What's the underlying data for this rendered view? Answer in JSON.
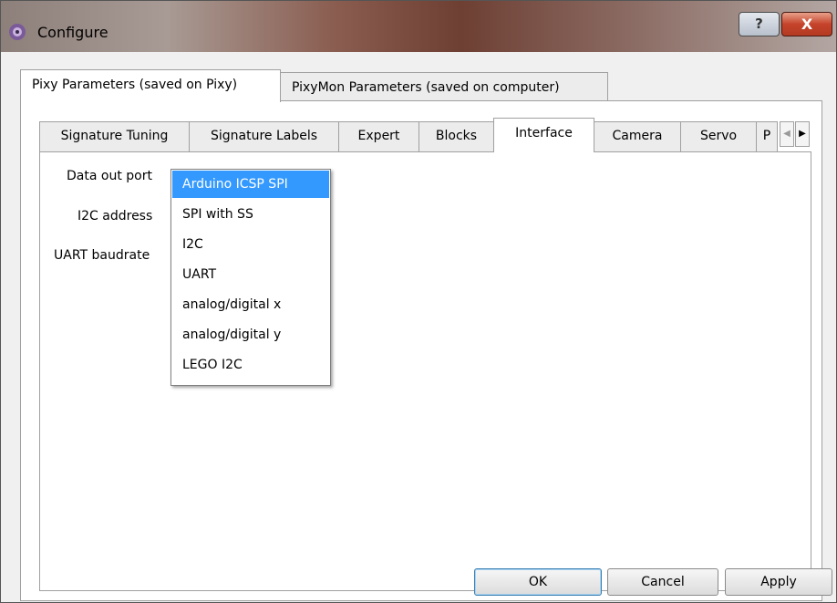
{
  "window": {
    "title": "Configure",
    "help_label": "?",
    "close_label": "X"
  },
  "outer_tabs": [
    {
      "label": "Pixy Parameters (saved on Pixy)",
      "active": true
    },
    {
      "label": "PixyMon Parameters (saved on computer)",
      "active": false
    }
  ],
  "inner_tabs": [
    {
      "label": "Signature Tuning"
    },
    {
      "label": "Signature Labels"
    },
    {
      "label": "Expert"
    },
    {
      "label": "Blocks"
    },
    {
      "label": "Interface",
      "active": true
    },
    {
      "label": "Camera"
    },
    {
      "label": "Servo"
    },
    {
      "label": "P"
    }
  ],
  "tab_scroll": {
    "left_icon": "◀",
    "right_icon": "▶"
  },
  "form": {
    "data_out_port_label": "Data out port",
    "i2c_address_label": "I2C address",
    "uart_baudrate_label": "UART baudrate"
  },
  "dropdown": {
    "selected": "Arduino ICSP SPI",
    "options": [
      "Arduino ICSP SPI",
      "SPI with SS",
      "I2C",
      "UART",
      "analog/digital x",
      "analog/digital y",
      "LEGO I2C"
    ]
  },
  "buttons": {
    "ok": "OK",
    "cancel": "Cancel",
    "apply": "Apply"
  },
  "colors": {
    "selection": "#3399ff",
    "close_button": "#c5432a"
  }
}
